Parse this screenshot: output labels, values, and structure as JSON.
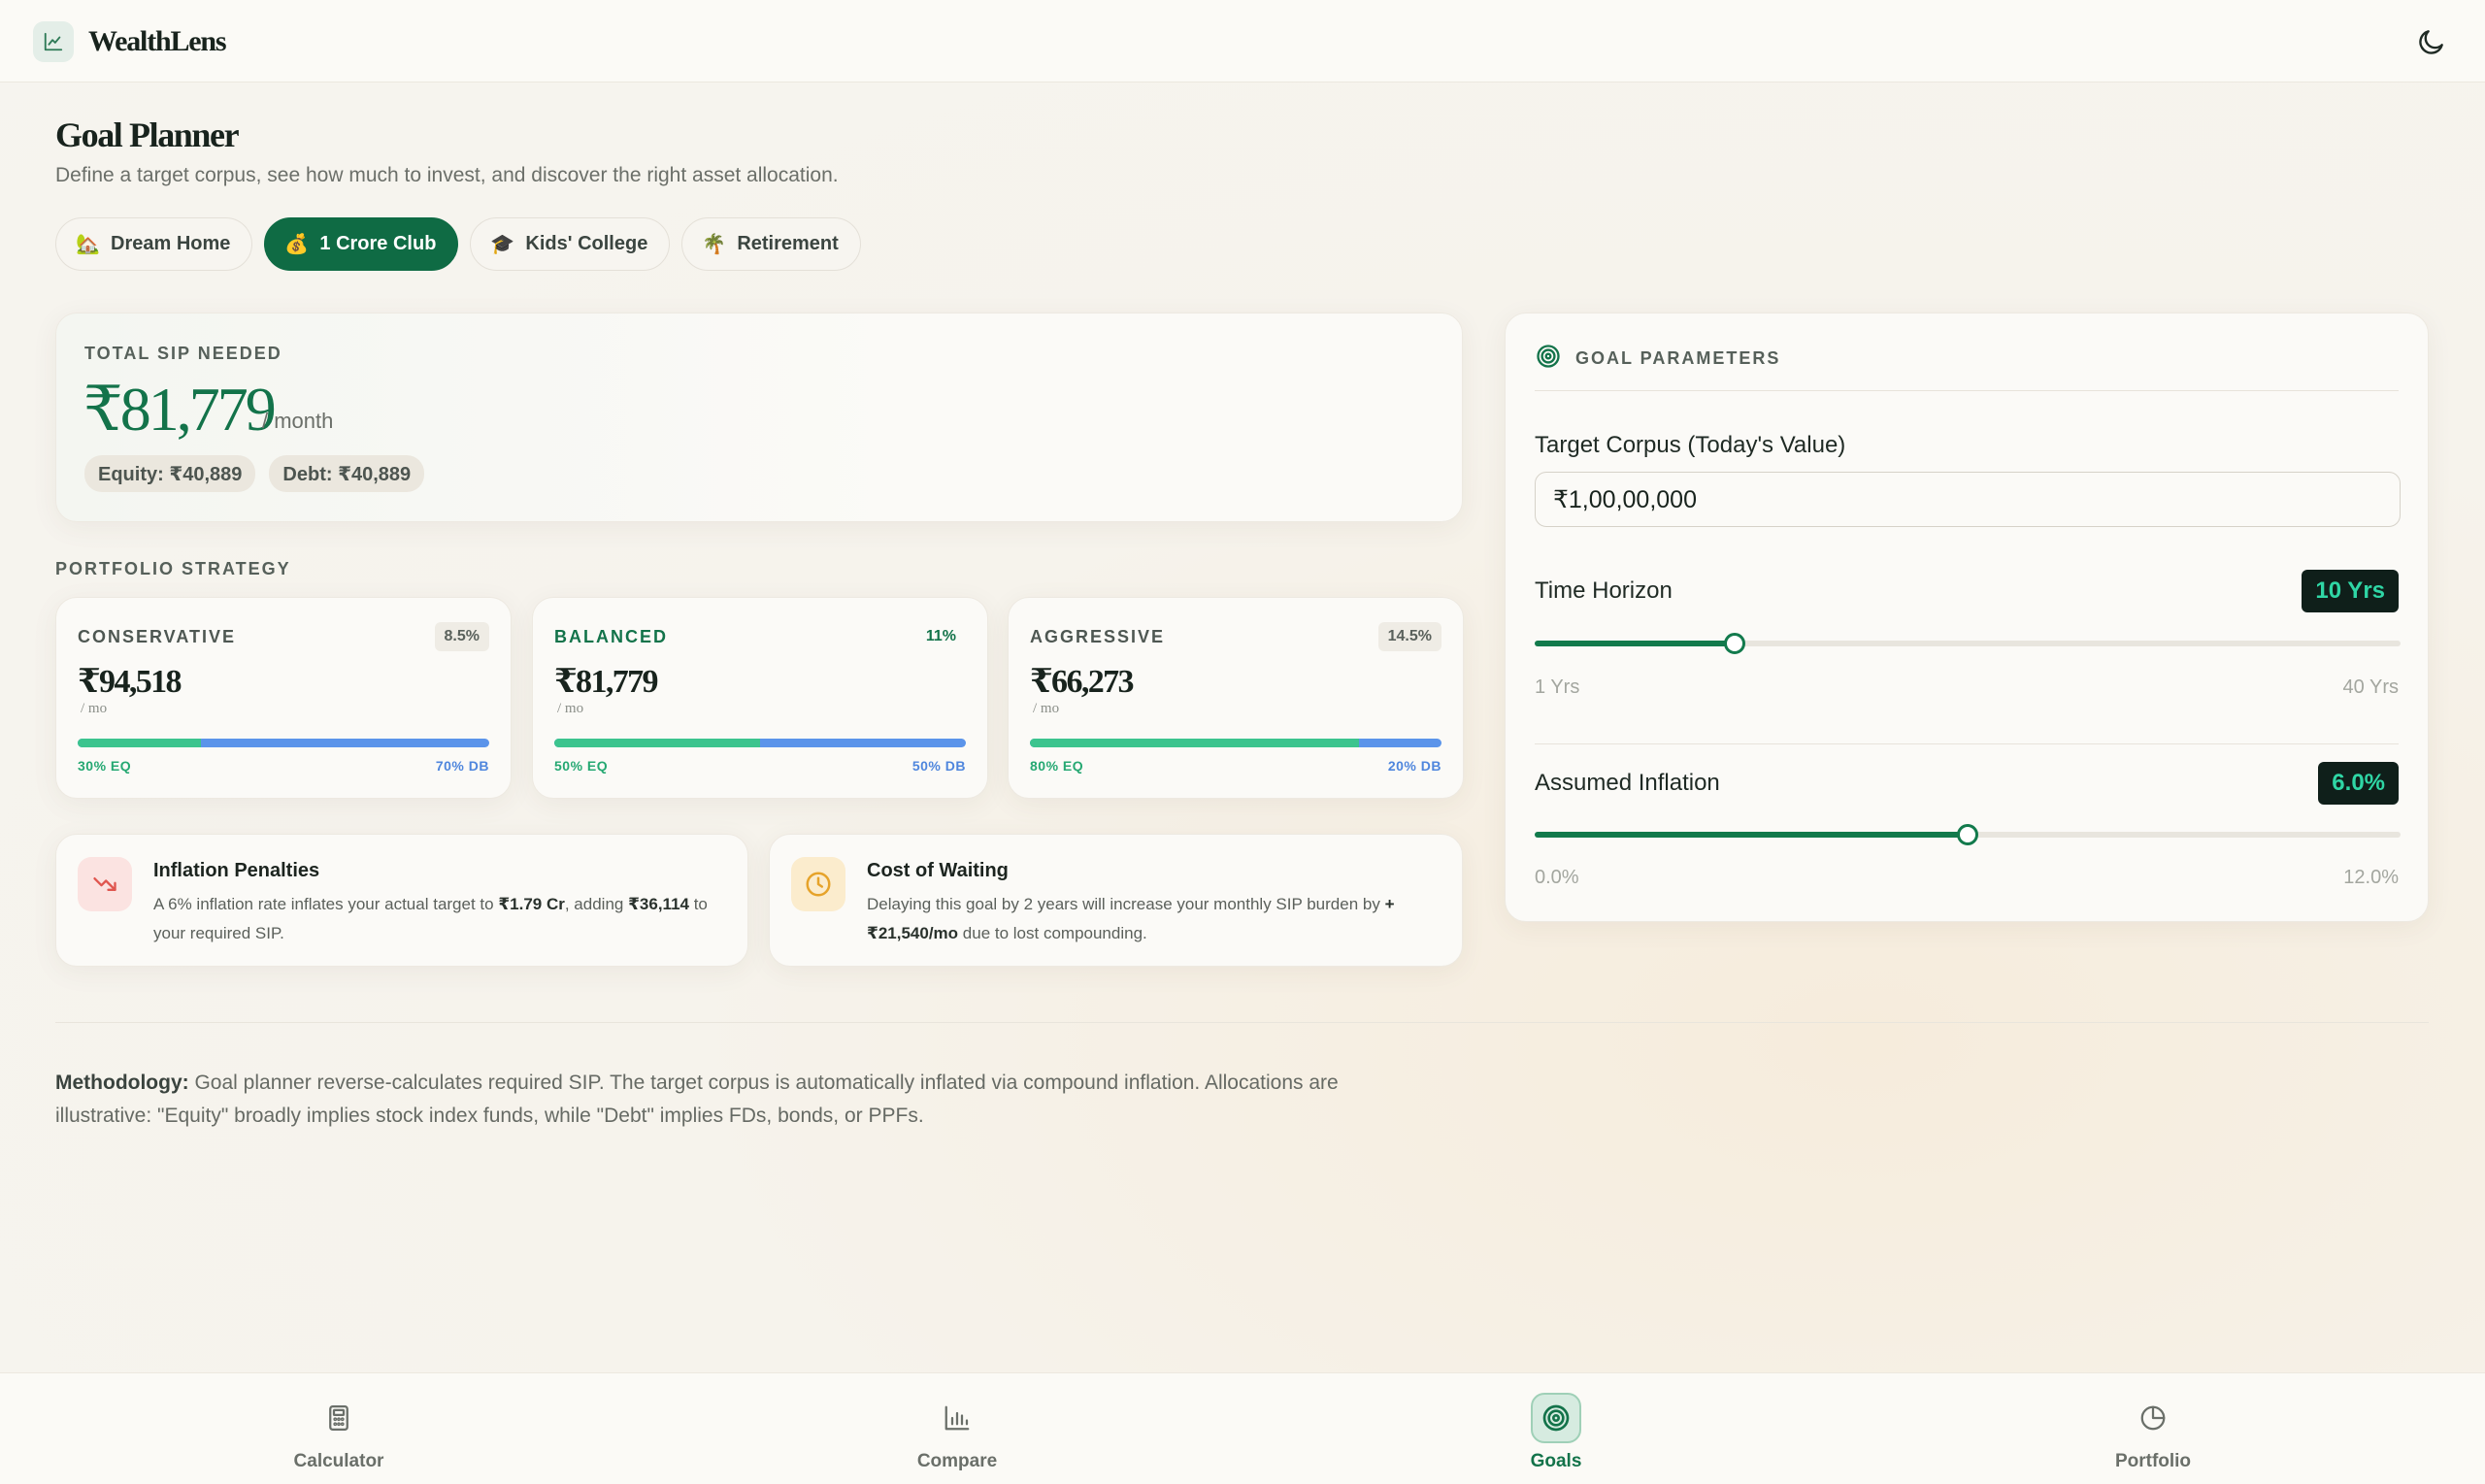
{
  "app": {
    "name": "WealthLens",
    "logo_icon": "chart-line-icon",
    "theme_toggle_icon": "moon-icon"
  },
  "page": {
    "title": "Goal Planner",
    "subtitle": "Define a target corpus, see how much to invest, and discover the right asset allocation."
  },
  "presets": [
    {
      "emoji": "🏡",
      "label": "Dream Home",
      "active": false
    },
    {
      "emoji": "💰",
      "label": "1 Crore Club",
      "active": true
    },
    {
      "emoji": "🎓",
      "label": "Kids' College",
      "active": false
    },
    {
      "emoji": "🌴",
      "label": "Retirement",
      "active": false
    }
  ],
  "sip": {
    "label": "TOTAL SIP NEEDED",
    "amount": "₹81,779",
    "per": "/ month",
    "equity": "Equity: ₹40,889",
    "debt": "Debt: ₹40,889"
  },
  "strategy": {
    "label": "PORTFOLIO STRATEGY",
    "items": [
      {
        "name": "CONSERVATIVE",
        "rate": "8.5%",
        "amount": "₹94,518",
        "per": "/ mo",
        "eq_pct": 30,
        "eq_label": "30% EQ",
        "db_label": "70% DB",
        "highlight": false
      },
      {
        "name": "BALANCED",
        "rate": "11%",
        "amount": "₹81,779",
        "per": "/ mo",
        "eq_pct": 50,
        "eq_label": "50% EQ",
        "db_label": "50% DB",
        "highlight": true
      },
      {
        "name": "AGGRESSIVE",
        "rate": "14.5%",
        "amount": "₹66,273",
        "per": "/ mo",
        "eq_pct": 80,
        "eq_label": "80% EQ",
        "db_label": "20% DB",
        "highlight": false
      }
    ]
  },
  "insights": {
    "inflation": {
      "title": "Inflation Penalties",
      "text_a": "A 6% inflation rate inflates your actual target to ",
      "text_b": "₹1.79 Cr",
      "text_c": ", adding ",
      "text_d": "₹36,114",
      "text_e": " to your required SIP."
    },
    "waiting": {
      "title": "Cost of Waiting",
      "text_a": "Delaying this goal by 2 years will increase your monthly SIP burden by ",
      "text_b": "+ ₹21,540/mo",
      "text_c": " due to lost compounding."
    }
  },
  "params": {
    "title": "GOAL PARAMETERS",
    "corpus_label": "Target Corpus (Today's Value)",
    "corpus_value": "₹1,00,00,000",
    "horizon": {
      "label": "Time Horizon",
      "value_label": "10 Yrs",
      "value": 10,
      "min": 1,
      "max": 40,
      "min_label": "1 Yrs",
      "max_label": "40 Yrs"
    },
    "inflation": {
      "label": "Assumed Inflation",
      "value_label": "6.0%",
      "value": 6.0,
      "min": 0,
      "max": 12,
      "min_label": "0.0%",
      "max_label": "12.0%"
    }
  },
  "methodology": {
    "bold": "Methodology:",
    "text": " Goal planner reverse-calculates required SIP. The target corpus is automatically inflated via compound inflation. Allocations are illustrative: \"Equity\" broadly implies stock index funds, while \"Debt\" implies FDs, bonds, or PPFs."
  },
  "nav": [
    {
      "label": "Calculator",
      "icon": "calculator-icon",
      "active": false
    },
    {
      "label": "Compare",
      "icon": "bar-chart-icon",
      "active": false
    },
    {
      "label": "Goals",
      "icon": "target-icon",
      "active": true
    },
    {
      "label": "Portfolio",
      "icon": "pie-chart-icon",
      "active": false
    }
  ],
  "colors": {
    "brand": "#0f6b44",
    "equity": "#3cc48e",
    "debt": "#5b94ea",
    "badge_bg": "#0f1f1a",
    "badge_text": "#2fd6a5"
  }
}
